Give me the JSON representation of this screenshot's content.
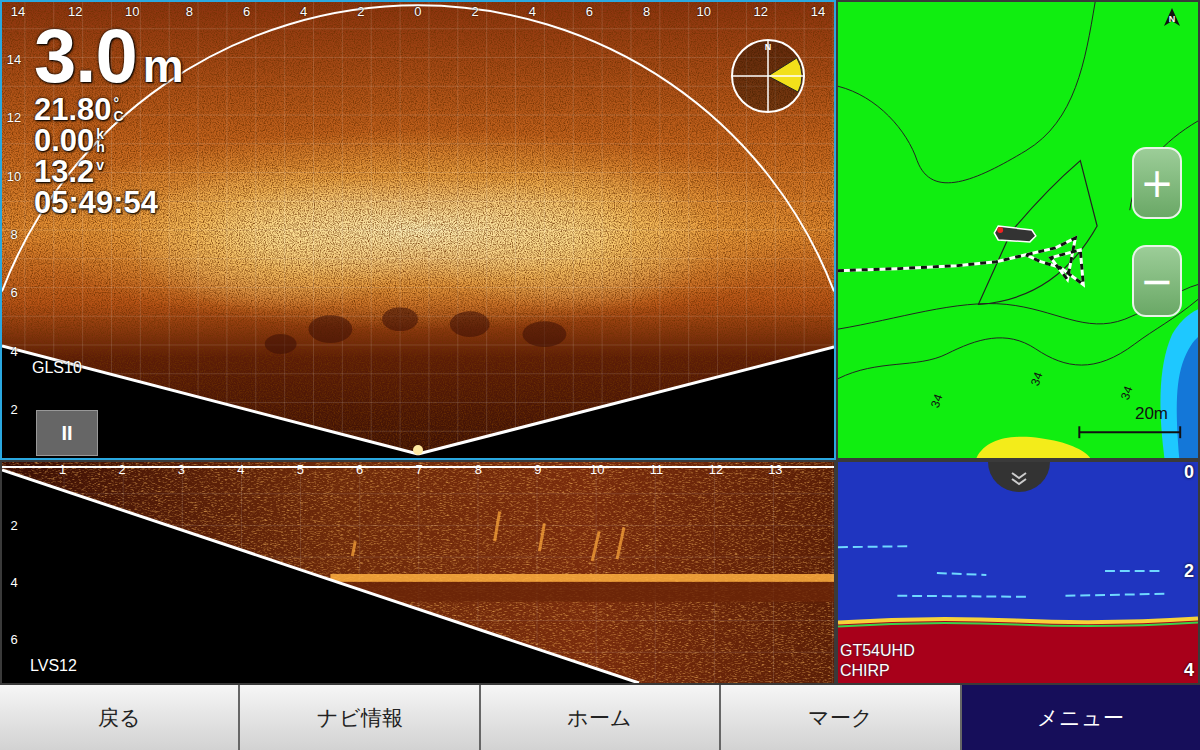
{
  "sonar_main": {
    "model": "GLS10",
    "active": true,
    "depth": "3.0",
    "depth_unit": "m",
    "readouts": [
      {
        "value": "21.80",
        "unit": [
          "°",
          "C"
        ]
      },
      {
        "value": "0.00",
        "unit": [
          "k",
          "h"
        ]
      },
      {
        "value": "13.2",
        "unit": [
          "v"
        ]
      },
      {
        "value": "05:49:54",
        "unit": []
      }
    ],
    "top_axis": [
      "14",
      "12",
      "10",
      "8",
      "6",
      "4",
      "2",
      "0",
      "2",
      "4",
      "6",
      "8",
      "10",
      "12",
      "14"
    ],
    "left_axis": [
      "14",
      "12",
      "10",
      "8",
      "6",
      "4",
      "2"
    ],
    "pause_button": "II",
    "compass": {
      "label": "N",
      "sector": [
        58,
        118
      ]
    }
  },
  "sonar_side": {
    "model": "LVS12",
    "active": false,
    "top_axis": [
      "1",
      "2",
      "3",
      "4",
      "5",
      "6",
      "7",
      "8",
      "9",
      "10",
      "11",
      "12",
      "13"
    ],
    "left_axis": [
      "2",
      "4",
      "6"
    ]
  },
  "map": {
    "active": false,
    "north": "N",
    "zoom_in": "+",
    "zoom_out": "−",
    "contour_labels": [
      "34",
      "34",
      "34"
    ],
    "scale": "20m"
  },
  "sonar_down": {
    "active": false,
    "model": "GT54UHD",
    "mode": "CHIRP",
    "depth_axis": [
      "0",
      "2",
      "4"
    ]
  },
  "buttons": [
    {
      "label": "戻る",
      "selected": false
    },
    {
      "label": "ナビ情報",
      "selected": false
    },
    {
      "label": "ホーム",
      "selected": false
    },
    {
      "label": "マーク",
      "selected": false
    },
    {
      "label": "メニュー",
      "selected": true
    }
  ]
}
